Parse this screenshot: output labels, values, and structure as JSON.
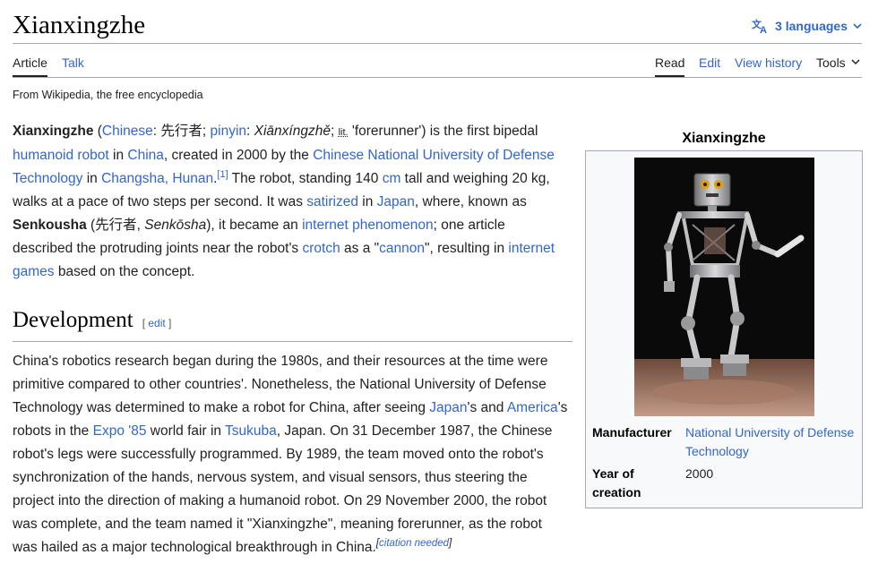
{
  "page": {
    "title": "Xianxingzhe",
    "languages_label": "3 languages",
    "tagline": "From Wikipedia, the free encyclopedia"
  },
  "tabs": {
    "article": "Article",
    "talk": "Talk",
    "read": "Read",
    "edit": "Edit",
    "history": "View history",
    "tools": "Tools"
  },
  "lead": {
    "name": "Xianxingzhe",
    "t1": " (",
    "chinese": "Chinese",
    "t2": ": 先行者; ",
    "pinyin": "pinyin",
    "t3": ": ",
    "pinyin_text": "Xiānxíngzhě",
    "t4": "; ",
    "lit": "lit.",
    "t5": " 'forerunner') is the first bipedal ",
    "humanoid": "humanoid robot",
    "t6": " in ",
    "china": "China",
    "t7": ", created in 2000 by the ",
    "nudt": "Chinese National University of Defense Technology",
    "t8": " in ",
    "changsha": "Changsha, Hunan",
    "t9": ".",
    "ref1": "[1]",
    "t10": " The robot, standing 140 ",
    "cm": "cm",
    "t11": " tall and weighing 20 kg, walks at a pace of two steps per second. It was ",
    "satirized": "satirized",
    "t12": " in ",
    "japan": "Japan",
    "t13": ", where, known as ",
    "senkousha": "Senkousha",
    "t14": " (先行者, ",
    "senkosha": "Senkōsha",
    "t15": "), it became an ",
    "internet_phen": "internet phenomenon",
    "t16": "; one article described the protruding joints near the robot's ",
    "crotch": "crotch",
    "t17": " as a \"",
    "cannon": "cannon",
    "t18": "\", resulting in ",
    "internet_games": "internet games",
    "t19": " based on the concept."
  },
  "development": {
    "heading": "Development",
    "edit_open": "[ ",
    "edit": "edit",
    "edit_close": " ]",
    "t1": "China's robotics research began during the 1980s, and their resources at the time were primitive compared to other countries'. Nonetheless, the National University of Defense Technology was determined to make a robot for China, after seeing ",
    "japan": "Japan",
    "t2": "'s and ",
    "america": "America",
    "t3": "'s robots in the ",
    "expo": "Expo '85",
    "t4": " world fair in ",
    "tsukuba": "Tsukuba",
    "t5": ", Japan. On 31 December 1987, the Chinese robot's legs were successfully programmed. By 1989, the team moved onto the robot's synchronization of the hands, nervous system, and visual sensors, thus steering the project into the direction of making a humanoid robot. On 29 November 2000, the robot was complete, and the team named it \"Xianxingzhe\", meaning forerunner, as the robot was hailed as a major technological breakthrough in China.",
    "cn_open": "[",
    "cn": "citation needed",
    "cn_close": "]"
  },
  "infobox": {
    "caption": "Xianxingzhe",
    "manufacturer_label": "Manufacturer",
    "manufacturer_value": "National University of Defense Technology",
    "year_label": "Year of creation",
    "year_value": "2000"
  },
  "colors": {
    "link": "#3366cc",
    "text": "#202122",
    "rule": "#a2a9b1",
    "infobox_bg": "#f8f9fa"
  },
  "icons": [
    "translate-icon",
    "chevron-down-icon",
    "robot-photo"
  ]
}
